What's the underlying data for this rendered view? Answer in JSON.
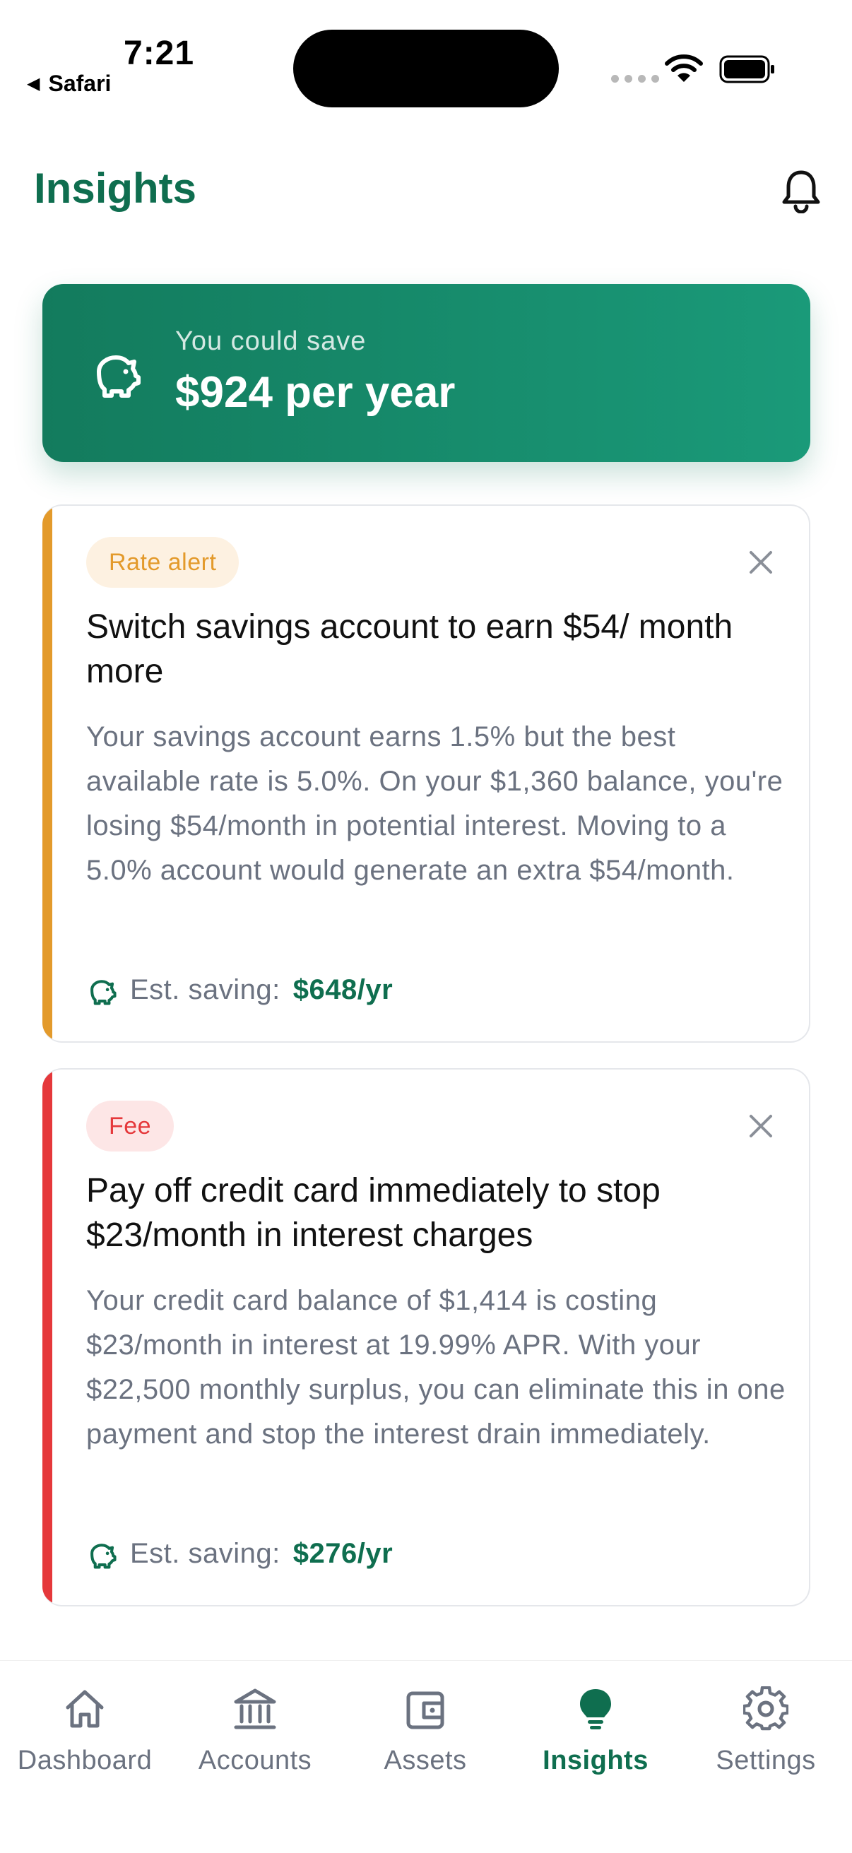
{
  "status_bar": {
    "time": "7:21",
    "back_label": "Safari"
  },
  "header": {
    "title": "Insights"
  },
  "summary": {
    "label": "You could save",
    "amount": "$924 per year"
  },
  "insights": [
    {
      "badge": "Rate alert",
      "title": "Switch savings account to earn $54/ month more",
      "body": "Your savings account earns 1.5% but the best available rate is 5.0%. On your $1,360 balance, you're losing $54/month in potential interest. Moving to a 5.0% account would generate an extra $54/month.",
      "saving_label": "Est. saving:",
      "saving_value": "$648/yr"
    },
    {
      "badge": "Fee",
      "title": "Pay off credit card immediately to stop $23/month in interest charges",
      "body": "Your credit card balance of $1,414 is costing $23/month in interest at 19.99% APR. With your $22,500 monthly surplus, you can eliminate this in one payment and stop the interest drain immediately.",
      "saving_label": "Est. saving:",
      "saving_value": "$276/yr"
    }
  ],
  "tabs": [
    {
      "label": "Dashboard",
      "icon": "home-icon"
    },
    {
      "label": "Accounts",
      "icon": "bank-icon"
    },
    {
      "label": "Assets",
      "icon": "wallet-icon"
    },
    {
      "label": "Insights",
      "icon": "lightbulb-icon",
      "active": true
    },
    {
      "label": "Settings",
      "icon": "gear-icon"
    }
  ],
  "colors": {
    "brand": "#0f6e4f",
    "rate_alert_accent": "#e39a2b",
    "fee_accent": "#e5383b"
  }
}
